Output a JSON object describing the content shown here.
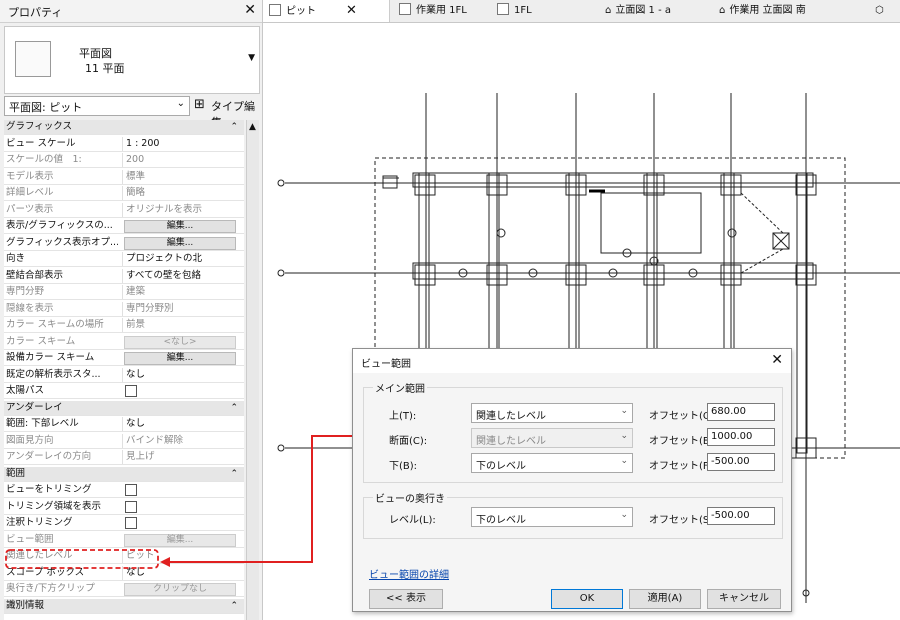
{
  "colors": {
    "accent_red": "#e02020",
    "link": "#0645ad",
    "ok_border": "#0078d7"
  },
  "properties": {
    "title": "プロパティ",
    "close": "✕",
    "type_line1": "平面図",
    "type_line2": "11 平面",
    "view_selector": "平面図: ピット",
    "edit_type": "タイプ編集",
    "rows": [
      {
        "k": "グラフィックス",
        "sec": true,
        "col": "⌃"
      },
      {
        "k": "ビュー スケール",
        "v": "1 : 200"
      },
      {
        "k": "スケールの値　1:",
        "v": "200",
        "dis": true
      },
      {
        "k": "モデル表示",
        "v": "標準",
        "dis": true
      },
      {
        "k": "詳細レベル",
        "v": "簡略",
        "dis": true
      },
      {
        "k": "パーツ表示",
        "v": "オリジナルを表示",
        "dis": true
      },
      {
        "k": "表示/グラフィックスの...",
        "btn": "編集..."
      },
      {
        "k": "グラフィックス表示オプ...",
        "btn": "編集..."
      },
      {
        "k": "向き",
        "v": "プロジェクトの北"
      },
      {
        "k": "壁結合部表示",
        "v": "すべての壁を包絡"
      },
      {
        "k": "専門分野",
        "v": "建築",
        "dis": true
      },
      {
        "k": "隠線を表示",
        "v": "専門分野別",
        "dis": true
      },
      {
        "k": "カラー スキームの場所",
        "v": "前景",
        "dis": true
      },
      {
        "k": "カラー スキーム",
        "btn": "<なし>",
        "btndis": true,
        "dis": true
      },
      {
        "k": "設備カラー スキーム",
        "btn": "編集..."
      },
      {
        "k": "既定の解析表示スタ...",
        "v": "なし"
      },
      {
        "k": "太陽パス",
        "chk": true
      },
      {
        "k": "アンダーレイ",
        "sec": true,
        "col": "⌃"
      },
      {
        "k": "範囲: 下部レベル",
        "v": "なし"
      },
      {
        "k": "図面見方向",
        "v": "バインド解除",
        "dis": true
      },
      {
        "k": "アンダーレイの方向",
        "v": "見上げ",
        "dis": true
      },
      {
        "k": "範囲",
        "sec": true,
        "col": "⌃"
      },
      {
        "k": "ビューをトリミング",
        "chk": true
      },
      {
        "k": "トリミング領域を表示",
        "chk": true
      },
      {
        "k": "注釈トリミング",
        "chk": true
      },
      {
        "k": "ビュー範囲",
        "btn": "編集...",
        "btndis": true,
        "dis": true
      },
      {
        "k": "関連したレベル",
        "v": "ピット",
        "dis": true
      },
      {
        "k": "スコープ ボックス",
        "v": "なし"
      },
      {
        "k": "奥行き/下方クリップ",
        "btn": "クリップなし",
        "btndis": true,
        "dis": true
      },
      {
        "k": "識別情報",
        "sec": true,
        "col": "⌃"
      }
    ]
  },
  "tabs": [
    {
      "label": "ピット",
      "active": true,
      "close": "✕"
    },
    {
      "label": "作業用 1FL"
    },
    {
      "label": "1FL"
    },
    {
      "label": "立面図 1 - a"
    },
    {
      "label": "作業用 立面図 南"
    }
  ],
  "dialog": {
    "title": "ビュー範囲",
    "close": "✕",
    "main_group": "メイン範囲",
    "top_label": "上(T):",
    "top_value": "関連したレベル",
    "top_offset_label": "オフセット(O):",
    "top_offset": "680.00",
    "cut_label": "断面(C):",
    "cut_value": "関連したレベル",
    "cut_offset_label": "オフセット(E):",
    "cut_offset": "1000.00",
    "bottom_label": "下(B):",
    "bottom_value": "下のレベル",
    "bottom_offset_label": "オフセット(F):",
    "bottom_offset": "-500.00",
    "depth_group": "ビューの奥行き",
    "level_label": "レベル(L):",
    "level_value": "下のレベル",
    "level_offset_label": "オフセット(S):",
    "level_offset": "-500.00",
    "detail_link": "ビュー範囲の詳細",
    "show_button": "<< 表示",
    "ok_button": "OK",
    "apply_button": "適用(A)",
    "cancel_button": "キャンセル"
  }
}
